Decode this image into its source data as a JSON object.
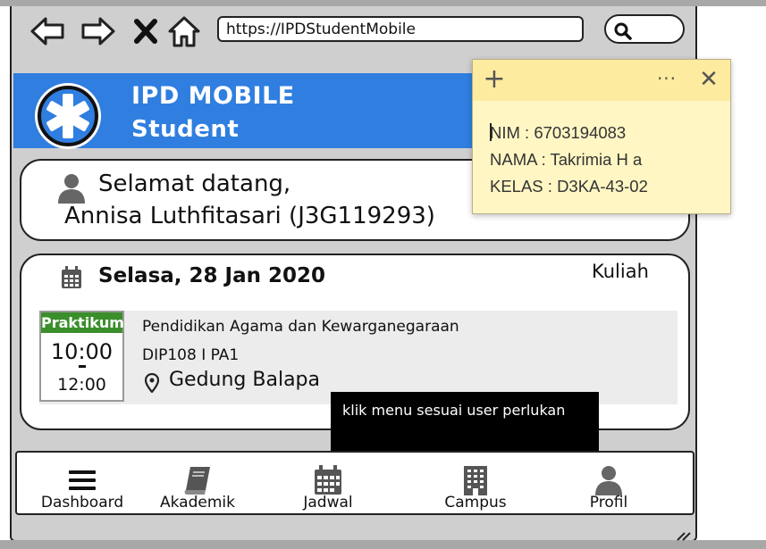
{
  "browser": {
    "url": "https://IPDStudentMobile"
  },
  "header": {
    "title": "IPD MOBILE",
    "subtitle": "Student"
  },
  "welcome": {
    "greeting": "Selamat datang,",
    "name": "Annisa Luthfitasari (J3G119293)"
  },
  "schedule": {
    "date": "Selasa, 28 Jan 2020",
    "type": "Kuliah",
    "class": {
      "tag": "Praktikum",
      "start": "10:00",
      "end": "12:00",
      "course": "Pendidikan Agama dan Kewarganegaraan",
      "code": "DIP108 I PA1",
      "location": "Gedung Balapa"
    }
  },
  "tooltip": {
    "text": "klik menu sesuai user perlukan"
  },
  "bottom_nav": {
    "items": [
      {
        "label": "Dashboard",
        "icon": "hamburger-icon"
      },
      {
        "label": "Akademik",
        "icon": "book-icon"
      },
      {
        "label": "Jadwal",
        "icon": "calendar-icon"
      },
      {
        "label": "Campus",
        "icon": "building-icon"
      },
      {
        "label": "Profil",
        "icon": "user-icon"
      }
    ]
  },
  "sticky_note": {
    "lines": [
      "NIM : 6703194083",
      "NAMA : Takrimia H a",
      "KELAS : D3KA-43-02"
    ]
  },
  "colors": {
    "header_blue": "#2f7ee0",
    "praktikum_green": "#3a8f2b",
    "sticky_yellow": "#fff6c3"
  }
}
